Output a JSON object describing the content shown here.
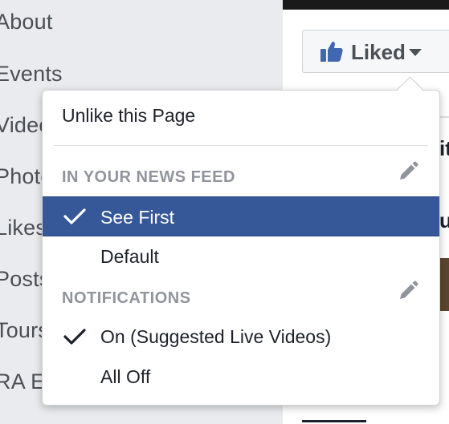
{
  "sidebar": {
    "items": [
      {
        "label": "About"
      },
      {
        "label": "Events"
      },
      {
        "label": "Videos"
      },
      {
        "label": "Photos"
      },
      {
        "label": "Likes"
      },
      {
        "label": "Posts"
      },
      {
        "label": "Tours"
      },
      {
        "label": "RA Events"
      }
    ]
  },
  "page": {
    "liked_button_label": "Liked",
    "bg_fragment_1": "it",
    "bg_fragment_2": "u'"
  },
  "menu": {
    "unlike_label": "Unlike this Page",
    "news_feed": {
      "header": "IN YOUR NEWS FEED",
      "options": [
        {
          "label": "See First",
          "checked": true,
          "selected": true
        },
        {
          "label": "Default",
          "checked": false,
          "selected": false
        }
      ]
    },
    "notifications": {
      "header": "NOTIFICATIONS",
      "options": [
        {
          "label": "On (Suggested Live Videos)",
          "checked": true
        },
        {
          "label": "All Off",
          "checked": false
        }
      ]
    }
  },
  "colors": {
    "selection_bg": "#365899",
    "brand_blue": "#4267b2",
    "section_gray": "#90949c"
  }
}
